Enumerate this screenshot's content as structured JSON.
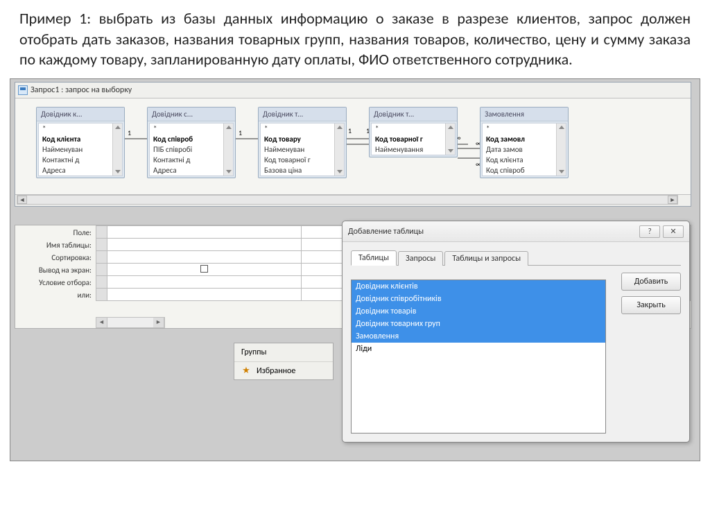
{
  "description": "Пример 1: выбрать из базы данных информацию о заказе в разрезе клиентов, запрос должен отобрать дать заказов, названия товарных групп, названия товаров, количество, цену и сумму заказа по каждому товару, запланированную дату оплаты, ФИО ответственного сотрудника.",
  "query_window": {
    "title": "Запрос1 : запрос на выборку"
  },
  "tables": [
    {
      "title": "Довідник к...",
      "pk": "Код клієнта",
      "fields": [
        "Найменуван",
        "Контактні д",
        "Адреса"
      ]
    },
    {
      "title": "Довідник с...",
      "pk": "Код співроб",
      "fields": [
        "ПІБ співробі",
        "Контактні д",
        "Адреса"
      ]
    },
    {
      "title": "Довідник т...",
      "pk": "Код товару",
      "fields": [
        "Найменуван",
        "Код товарної г",
        "Базова ціна"
      ]
    },
    {
      "title": "Довідник т...",
      "pk": "Код товарної г",
      "fields": [
        "Найменування"
      ]
    },
    {
      "title": "Замовлення",
      "pk": "Код замовл",
      "fields": [
        "Дата замов",
        "Код клієнта",
        "Код співроб"
      ]
    }
  ],
  "grid_labels": [
    "Поле:",
    "Имя таблицы:",
    "Сортировка:",
    "Вывод на экран:",
    "Условие отбора:",
    "или:"
  ],
  "groups_panel": {
    "groups": "Группы",
    "favorites": "Избранное"
  },
  "dialog": {
    "title": "Добавление таблицы",
    "tabs": [
      "Таблицы",
      "Запросы",
      "Таблицы и запросы"
    ],
    "list_selected": [
      "Довідник клієнтів",
      "Довідник співробітників",
      "Довідник товарів",
      "Довідник товарних груп",
      "Замовлення"
    ],
    "list_unselected": [
      "Ліди"
    ],
    "buttons": {
      "add": "Добавить",
      "close": "Закрыть"
    }
  }
}
